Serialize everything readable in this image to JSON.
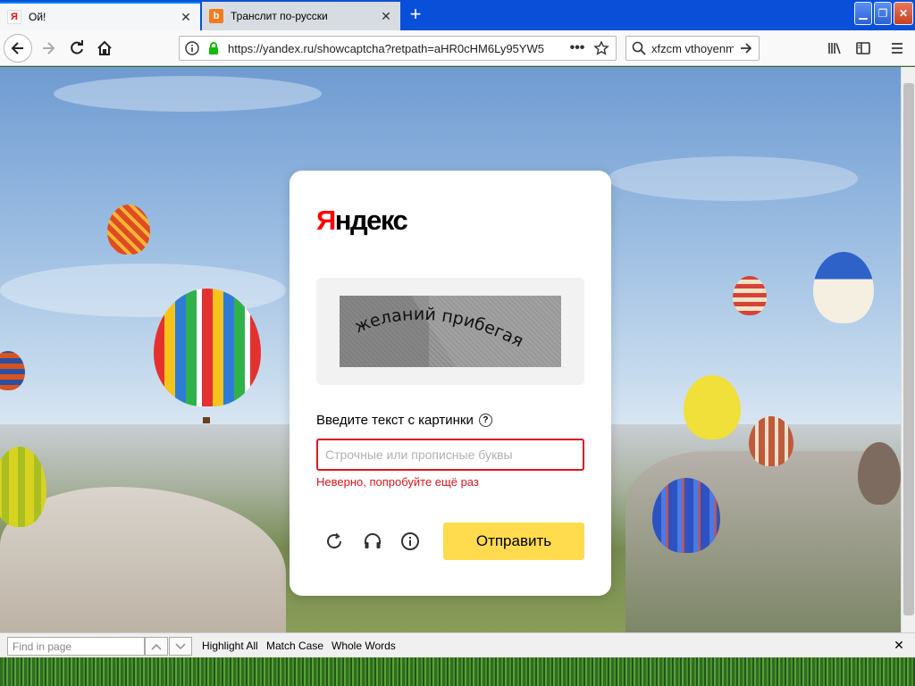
{
  "browser": {
    "tabs": [
      {
        "title": "Ой!",
        "favicon": "yandex-favicon",
        "active": true
      },
      {
        "title": "Транслит по-русски",
        "favicon": "translit-favicon",
        "active": false
      }
    ],
    "url": "https://yandex.ru/showcaptcha?retpath=aHR0cHM6Ly95YW5",
    "search_value": "xfzcm vthoyenm"
  },
  "page": {
    "logo_first": "Я",
    "logo_rest": "ндекс",
    "captcha_text": "желаний прибегая",
    "prompt": "Введите текст с картинки",
    "help_icon": "?",
    "placeholder": "Строчные или прописные буквы",
    "error": "Неверно, попробуйте ещё раз",
    "submit": "Отправить"
  },
  "find_bar": {
    "placeholder": "Find in page",
    "highlight_all": "Highlight All",
    "match_case": "Match Case",
    "whole_words": "Whole Words"
  },
  "colors": {
    "accent_yellow": "#ffdb4d",
    "error_red": "#e0141e",
    "logo_red": "#ff0000"
  }
}
